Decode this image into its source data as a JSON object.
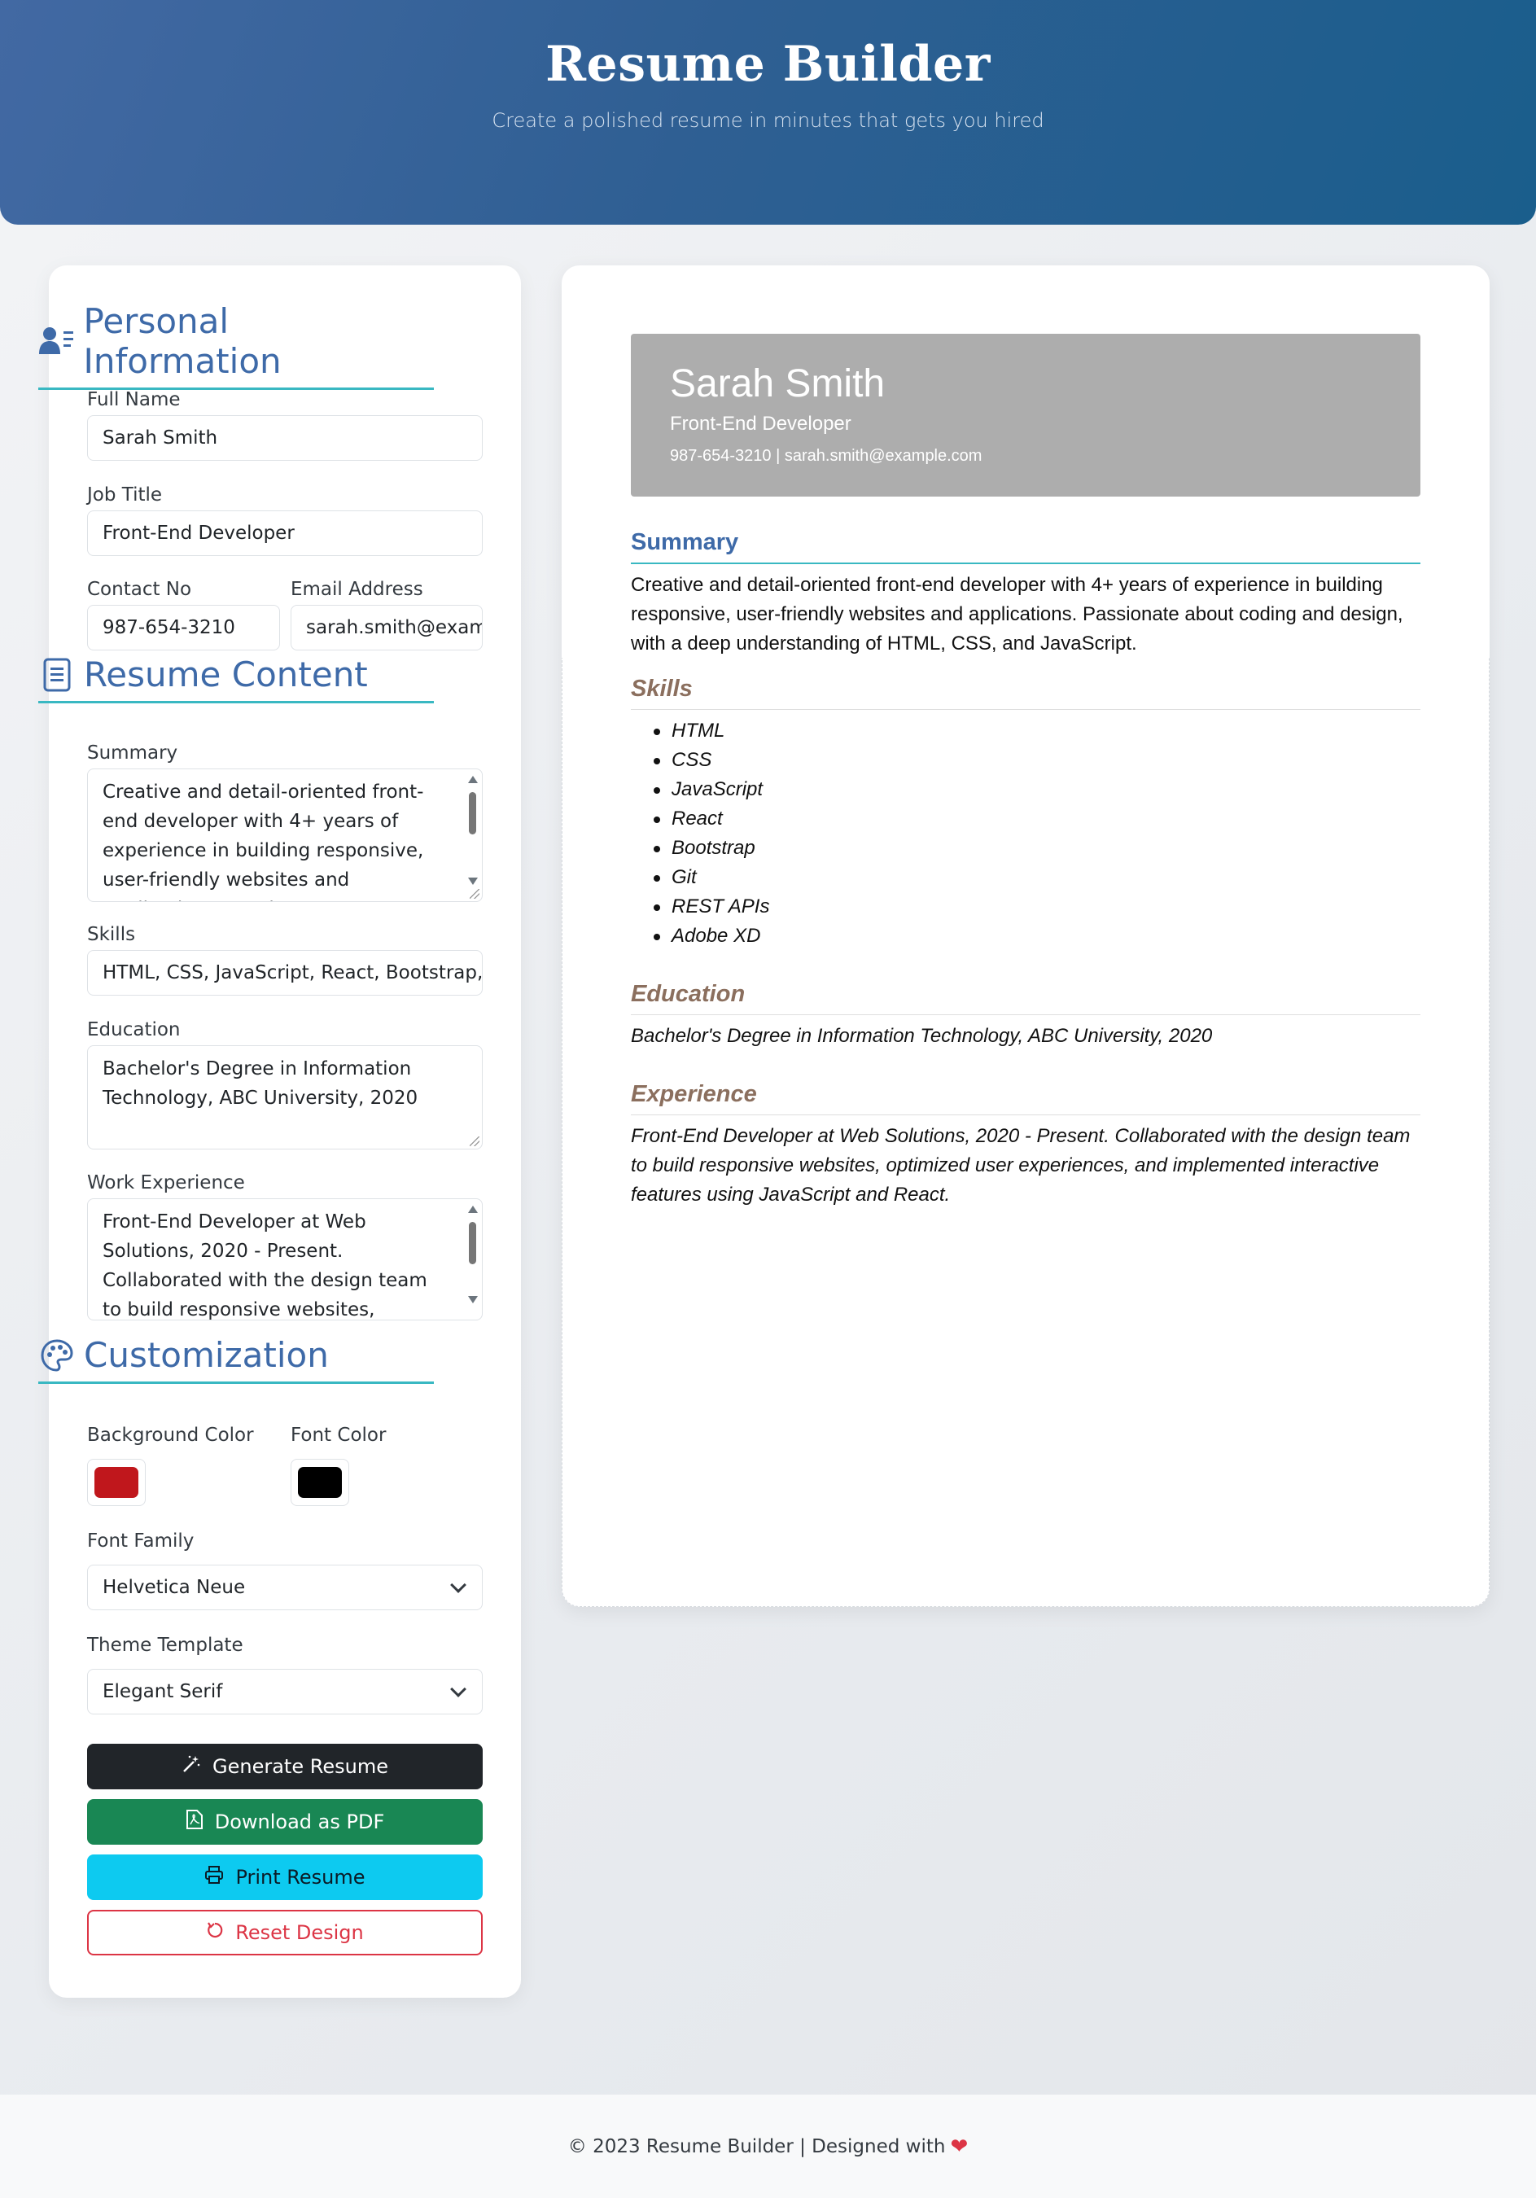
{
  "header": {
    "title": "Resume Builder",
    "subtitle": "Create a polished resume in minutes that gets you hired"
  },
  "form": {
    "personal_title": "Personal Information",
    "full_name_label": "Full Name",
    "full_name_value": "Sarah Smith",
    "job_title_label": "Job Title",
    "job_title_value": "Front-End Developer",
    "contact_label": "Contact No",
    "contact_value": "987-654-3210",
    "email_label": "Email Address",
    "email_value": "sarah.smith@exam",
    "content_title": "Resume Content",
    "summary_label": "Summary",
    "summary_value": "Creative and detail-oriented front-end developer with 4+ years of experience in building responsive, user-friendly websites and applications. Passionate",
    "skills_label": "Skills",
    "skills_value": "HTML, CSS, JavaScript, React, Bootstrap, G",
    "education_label": "Education",
    "education_value": "Bachelor's Degree in Information Technology, ABC University, 2020",
    "experience_label": "Work Experience",
    "experience_value": "Front-End Developer at Web Solutions, 2020 - Present. Collaborated with the design team to build responsive websites, optimized user experiences,",
    "custom_title": "Customization",
    "bg_color_label": "Background Color",
    "bg_color": "#c0171c",
    "font_color_label": "Font Color",
    "font_color": "#000000",
    "font_family_label": "Font Family",
    "font_family_value": "Helvetica Neue",
    "theme_label": "Theme Template",
    "theme_value": "Elegant Serif"
  },
  "buttons": {
    "generate": "Generate Resume",
    "download": "Download as PDF",
    "print": "Print Resume",
    "reset": "Reset Design"
  },
  "preview": {
    "name": "Sarah Smith",
    "title": "Front-End Developer",
    "contact": "987-654-3210 | sarah.smith@example.com",
    "summary_heading": "Summary",
    "summary_text": "Creative and detail-oriented front-end developer with 4+ years of experience in building responsive, user-friendly websites and applications. Passionate about coding and design, with a deep understanding of HTML, CSS, and JavaScript.",
    "skills_heading": "Skills",
    "skills": [
      "HTML",
      "CSS",
      "JavaScript",
      "React",
      "Bootstrap",
      "Git",
      "REST APIs",
      "Adobe XD"
    ],
    "education_heading": "Education",
    "education_text": "Bachelor's Degree in Information Technology, ABC University, 2020",
    "experience_heading": "Experience",
    "experience_text": "Front-End Developer at Web Solutions, 2020 - Present. Collaborated with the design team to build responsive websites, optimized user experiences, and implemented interactive features using JavaScript and React."
  },
  "footer": {
    "text": "© 2023 Resume Builder | Designed with"
  },
  "icons": {
    "personal": "user-details-icon",
    "content": "document-icon",
    "custom": "palette-icon",
    "generate": "magic-wand-icon",
    "download": "pdf-file-icon",
    "print": "printer-icon",
    "reset": "reset-icon",
    "heart": "heart-icon"
  }
}
